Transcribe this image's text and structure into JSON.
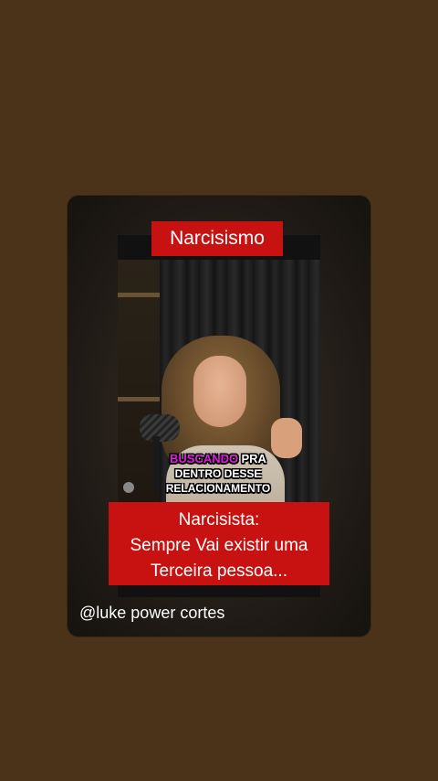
{
  "header": {
    "topic": "Narcisismo"
  },
  "video": {
    "subtitle_highlight": "BUSCANDO",
    "subtitle_rest_line1": "PRA",
    "subtitle_line2": "DENTRO DESSE",
    "subtitle_line3": "RELACIONAMENTO"
  },
  "caption": {
    "line1": "Narcisista:",
    "line2": "Sempre Vai existir uma",
    "line3": "Terceira pessoa..."
  },
  "footer": {
    "handle": "@luke power cortes"
  },
  "colors": {
    "background": "#4a3319",
    "banner": "#c81212",
    "highlight": "#e11be0"
  }
}
